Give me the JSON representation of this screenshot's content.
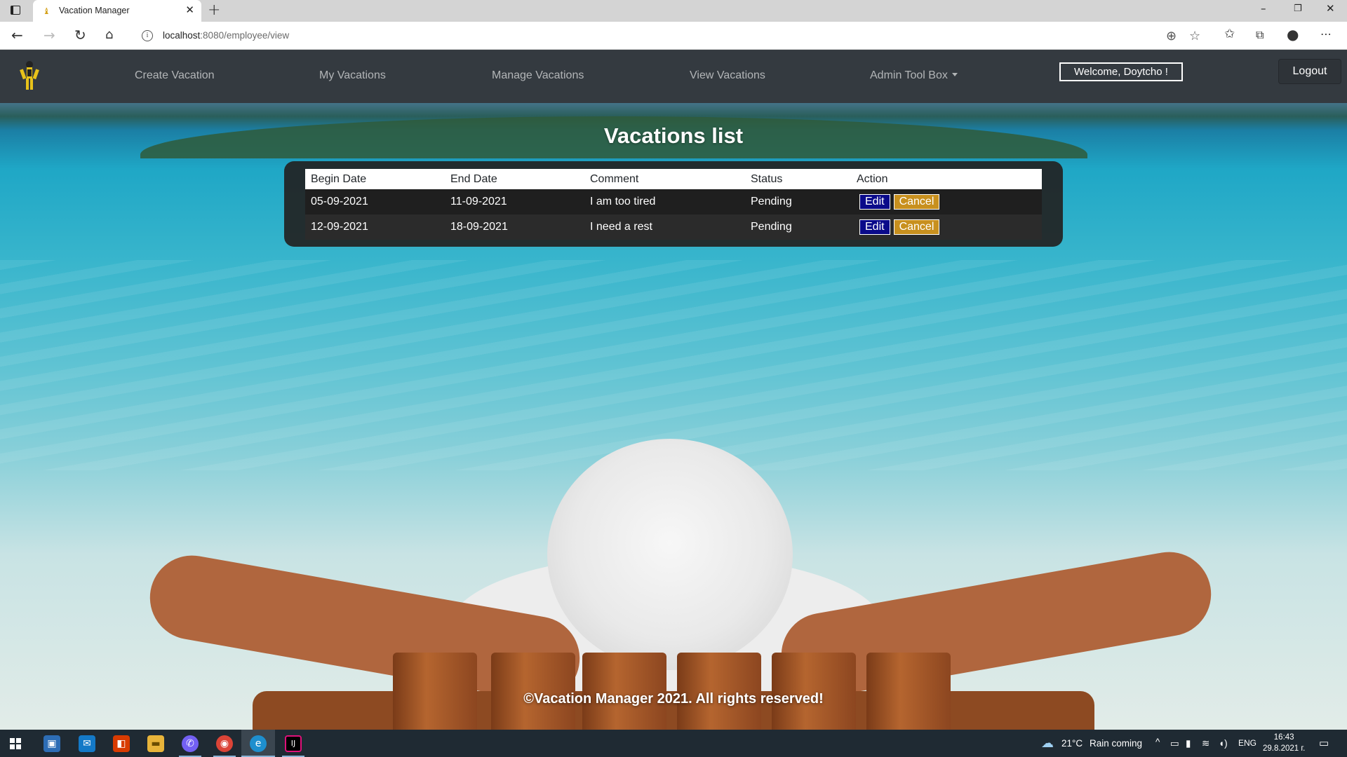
{
  "browser": {
    "tab_title": "Vacation Manager",
    "url_host": "localhost",
    "url_path": ":8080/employee/view"
  },
  "navbar": {
    "links": [
      "Create Vacation",
      "My Vacations",
      "Manage Vacations",
      "View Vacations",
      "Admin Tool Box"
    ],
    "welcome": "Welcome, Doytcho !",
    "logout": "Logout"
  },
  "main": {
    "heading": "Vacations list",
    "columns": [
      "Begin Date",
      "End Date",
      "Comment",
      "Status",
      "Action"
    ],
    "rows": [
      {
        "begin": "05-09-2021",
        "end": "11-09-2021",
        "comment": "I am too tired",
        "status": "Pending",
        "edit": "Edit",
        "cancel": "Cancel"
      },
      {
        "begin": "12-09-2021",
        "end": "18-09-2021",
        "comment": "I need a rest",
        "status": "Pending",
        "edit": "Edit",
        "cancel": "Cancel"
      }
    ]
  },
  "footer": {
    "text": "©Vacation Manager 2021. All rights reserved!"
  },
  "taskbar": {
    "weather": "21°C",
    "weather_text": "Rain coming",
    "lang": "ENG",
    "time": "16:43",
    "date": "29.8.2021 г."
  },
  "colors": {
    "navbar": "#343a40",
    "edit_button": "#0a0a8a",
    "cancel_button": "#c8901e"
  }
}
